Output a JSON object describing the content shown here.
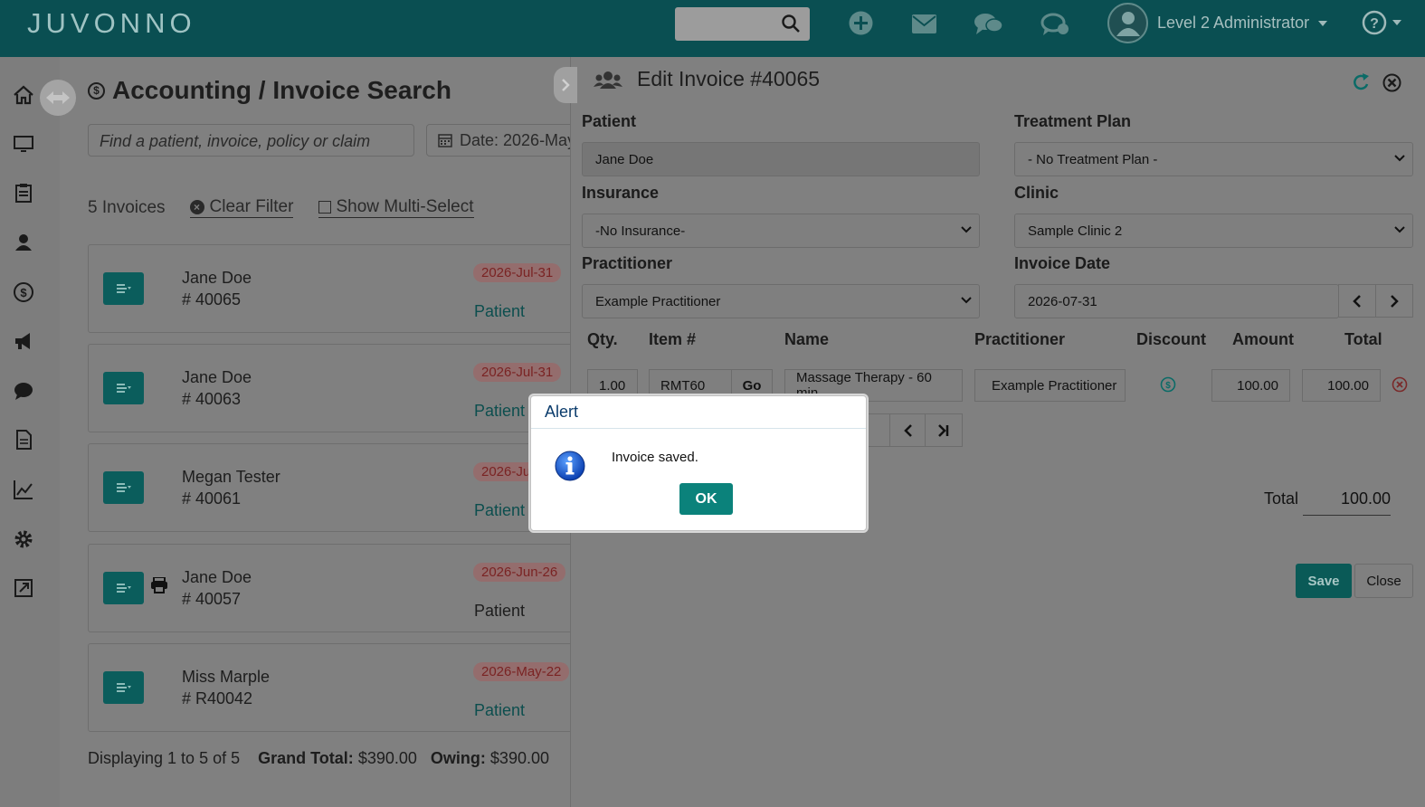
{
  "app": {
    "logo": "JUVONNO",
    "user": "Level 2 Administrator"
  },
  "nav": [
    "home-icon",
    "monitor-icon",
    "clipboard-icon",
    "people-icon",
    "dollar-icon",
    "megaphone-icon",
    "chat-icon",
    "document-icon",
    "chart-icon",
    "gear-icon",
    "export-icon"
  ],
  "page": {
    "title": "Accounting / Invoice Search",
    "search_placeholder": "Find a patient, invoice, policy or claim",
    "date_filter": "Date: 2026-May",
    "count": "5 Invoices",
    "clear_filter": "Clear Filter",
    "show_multi": "Show Multi-Select"
  },
  "invoices": [
    {
      "name": "Jane Doe",
      "number": "# 40065",
      "date": "2026-Jul-31",
      "type": "Patient"
    },
    {
      "name": "Jane Doe",
      "number": "# 40063",
      "date": "2026-Jul-31",
      "type": "Patient"
    },
    {
      "name": "Megan Tester",
      "number": "# 40061",
      "date": "2026-Ju",
      "type": "Patient"
    },
    {
      "name": "Jane Doe",
      "number": "# 40057",
      "date": "2026-Jun-26",
      "type": "Patient"
    },
    {
      "name": "Miss Marple",
      "number": "# R40042",
      "date": "2026-May-22",
      "type": "Patient"
    }
  ],
  "footer": {
    "displaying": "Displaying 1 to 5 of 5",
    "grand_total_label": "Grand Total:",
    "grand_total": "$390.00",
    "owing_label": "Owing:",
    "owing": "$390.00"
  },
  "edit": {
    "title": "Edit Invoice #40065",
    "patient_label": "Patient",
    "patient": "Jane Doe",
    "plan_label": "Treatment Plan",
    "plan": "- No Treatment Plan -",
    "insurance_label": "Insurance",
    "insurance": "-No Insurance-",
    "clinic_label": "Clinic",
    "clinic": "Sample Clinic 2",
    "practitioner_label": "Practitioner",
    "practitioner": "Example Practitioner",
    "invoice_date_label": "Invoice Date",
    "invoice_date": "2026-07-31",
    "columns": {
      "qty": "Qty.",
      "item": "Item #",
      "name": "Name",
      "practitioner": "Practitioner",
      "discount": "Discount",
      "amount": "Amount",
      "total": "Total"
    },
    "line": {
      "qty": "1.00",
      "item": "RMT60",
      "go": "Go",
      "name": "Massage Therapy - 60 min",
      "practitioner": "Example Practitioner",
      "amount": "100.00",
      "total": "100.00"
    },
    "total_label": "Total",
    "total": "100.00",
    "save": "Save",
    "close": "Close"
  },
  "alert": {
    "title": "Alert",
    "message": "Invoice saved.",
    "ok": "OK"
  }
}
